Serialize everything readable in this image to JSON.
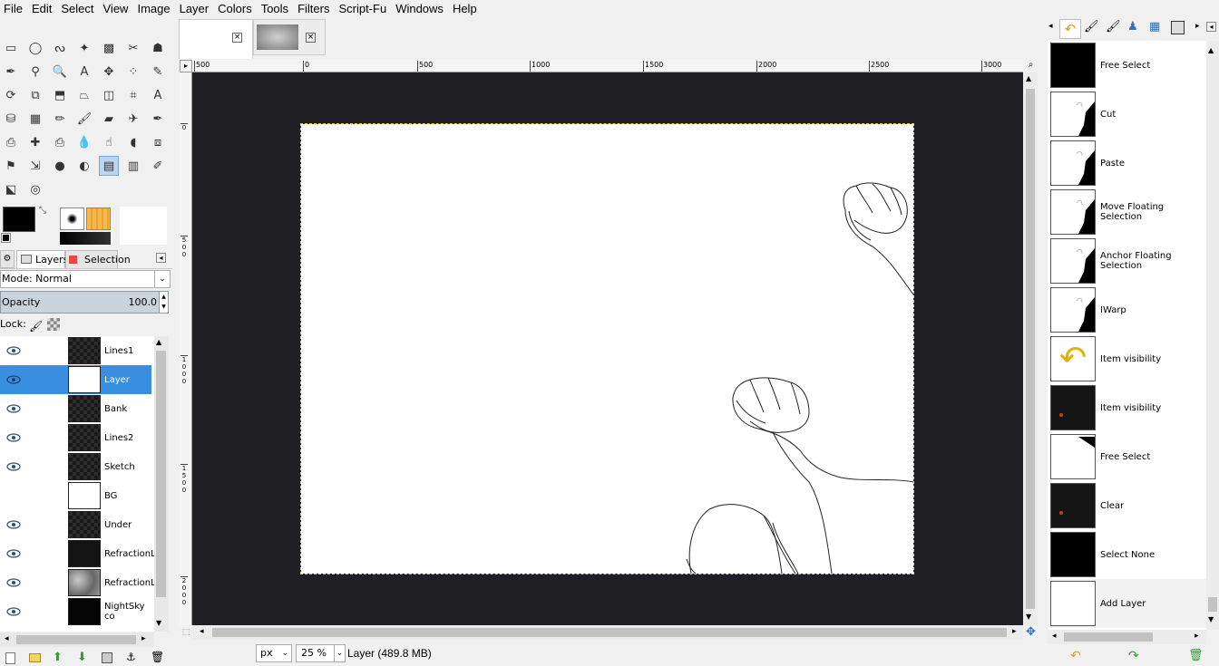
{
  "menubar": [
    "File",
    "Edit",
    "Select",
    "View",
    "Image",
    "Layer",
    "Colors",
    "Tools",
    "Filters",
    "Script-Fu",
    "Windows",
    "Help"
  ],
  "toolbox_icons": [
    "rect-select-icon",
    "ellipse-select-icon",
    "free-select-icon",
    "fuzzy-select-icon",
    "select-by-color-icon",
    "scissors-select-icon",
    "foreground-select-icon",
    "paths-icon",
    "color-picker-icon",
    "zoom-icon",
    "measure-icon",
    "move-icon",
    "align-icon",
    "crop-icon",
    "rotate-icon",
    "scale-icon",
    "shear-icon",
    "perspective-icon",
    "flip-icon",
    "cage-transform-icon",
    "text-icon",
    "bucket-fill-icon",
    "blend-icon",
    "pencil-icon",
    "paintbrush-icon",
    "eraser-icon",
    "airbrush-icon",
    "ink-icon",
    "clone-icon",
    "heal-icon",
    "perspective-clone-icon",
    "blur-icon",
    "smudge-icon",
    "dodge-burn-icon",
    "warp-icon",
    "mypaint-brush-icon",
    "unified-transform-icon",
    "color-balance-icon",
    "threshold-icon",
    "levels-icon",
    "curves-icon",
    "edit-icon",
    "gegl-icon",
    "spiral-icon"
  ],
  "layers_tabs": {
    "layers": "Layers",
    "selection": "Selection"
  },
  "mode": {
    "label": "Mode: Normal"
  },
  "opacity": {
    "label": "Opacity",
    "value": "100.0"
  },
  "lock": {
    "label": "Lock:"
  },
  "layers": [
    {
      "name": "Lines1",
      "visible": true,
      "thumb": "checker"
    },
    {
      "name": "Layer",
      "visible": true,
      "thumb": "white",
      "selected": true
    },
    {
      "name": "Bank",
      "visible": true,
      "thumb": "checker"
    },
    {
      "name": "Lines2",
      "visible": true,
      "thumb": "checker"
    },
    {
      "name": "Sketch",
      "visible": true,
      "thumb": "checker"
    },
    {
      "name": "BG",
      "visible": false,
      "thumb": "white"
    },
    {
      "name": "Under",
      "visible": true,
      "thumb": "checker"
    },
    {
      "name": "RefractionL",
      "visible": true,
      "thumb": "dark"
    },
    {
      "name": "RefractionL",
      "visible": true,
      "thumb": "gray"
    },
    {
      "name": "NightSky co",
      "visible": true,
      "thumb": "black"
    }
  ],
  "ruler_top": [
    "500",
    "0",
    "500",
    "1000",
    "1500",
    "2000",
    "2500",
    "3000"
  ],
  "ruler_left": [
    "0",
    "5\n0\n0",
    "1\n0\n0\n0",
    "1\n5\n0\n0",
    "2\n0\n0\n0"
  ],
  "status": {
    "unit": "px",
    "zoom": "25 %",
    "layer_info": "Layer (489.8 MB)"
  },
  "undo_history": [
    {
      "label": "Free Select",
      "thumb": "black"
    },
    {
      "label": "Cut",
      "thumb": "cut"
    },
    {
      "label": "Paste",
      "thumb": "cut"
    },
    {
      "label": "Move Floating Selection",
      "thumb": "cut"
    },
    {
      "label": "Anchor Floating Selection",
      "thumb": "cut"
    },
    {
      "label": "IWarp",
      "thumb": "cut"
    },
    {
      "label": "Item visibility",
      "thumb": "arrow"
    },
    {
      "label": "Item visibility",
      "thumb": "dark"
    },
    {
      "label": "Free Select",
      "thumb": "white-corner"
    },
    {
      "label": "Clear",
      "thumb": "dark"
    },
    {
      "label": "Select None",
      "thumb": "black"
    },
    {
      "label": "Add Layer",
      "thumb": "white",
      "selected": true
    }
  ]
}
